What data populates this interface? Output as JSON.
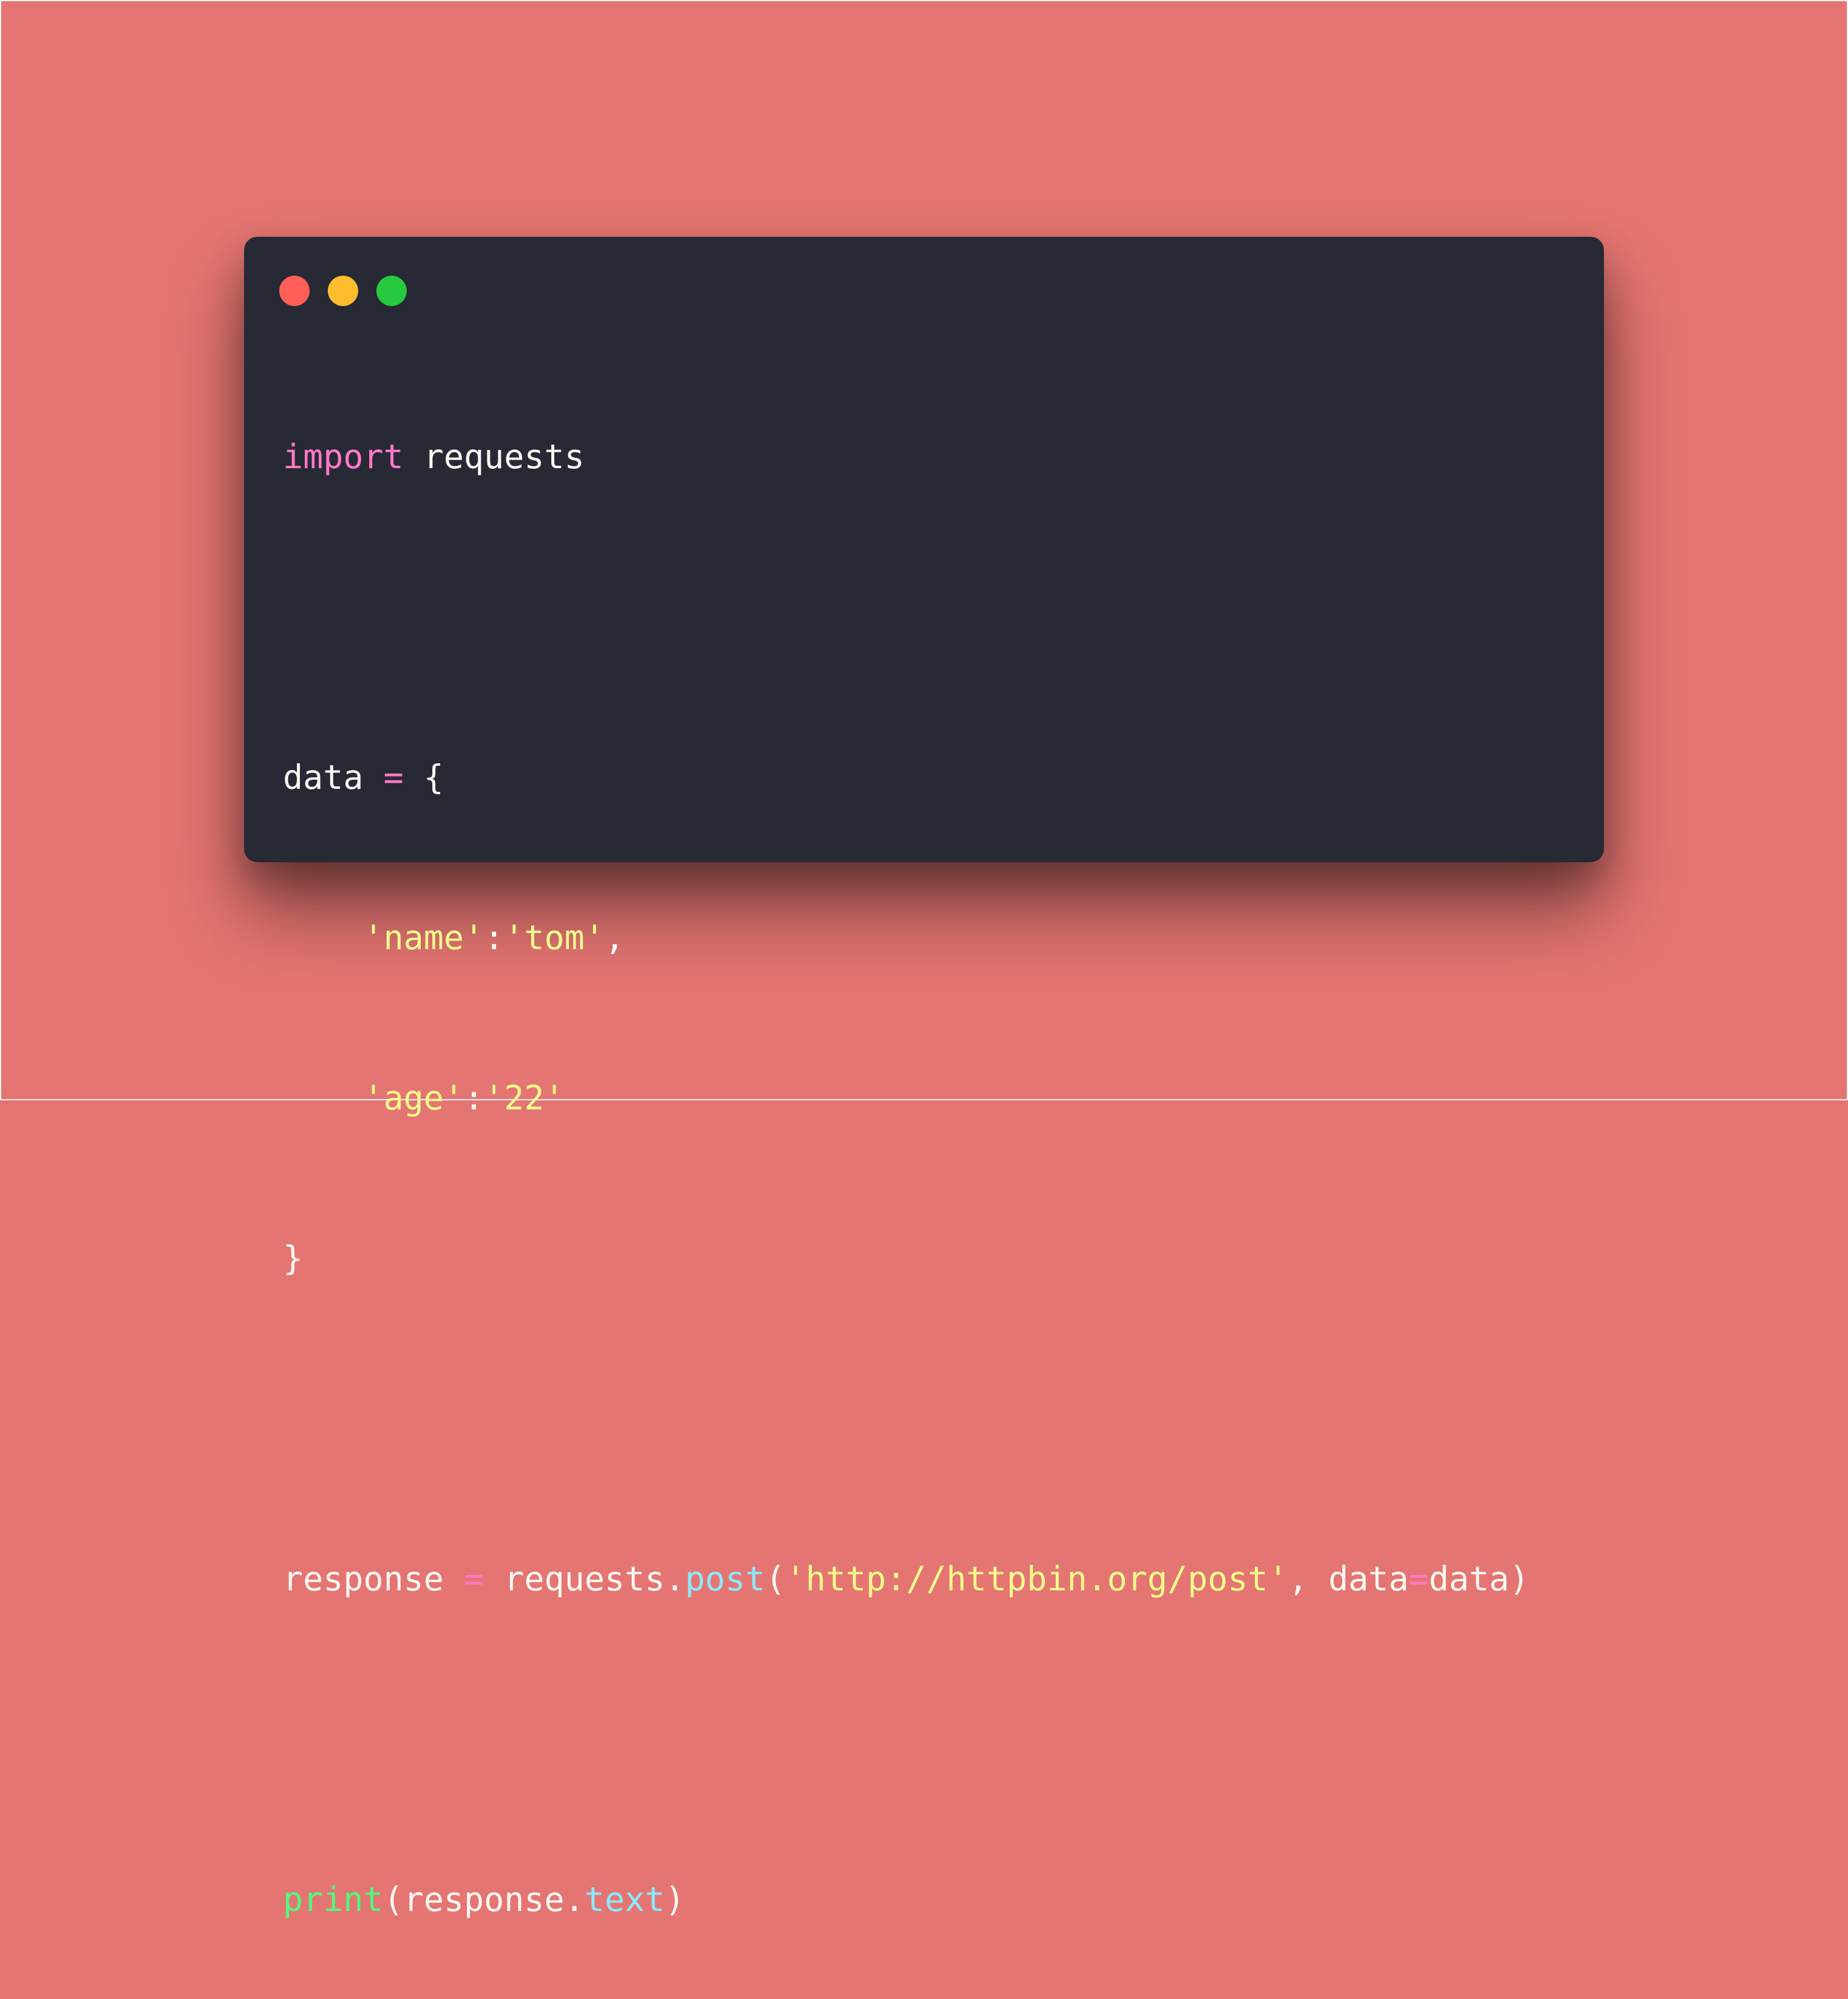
{
  "colors": {
    "background": "#e57572",
    "window": "#272935",
    "dot_close": "#ff5f56",
    "dot_minimize": "#ffbd2e",
    "dot_zoom": "#27c93f",
    "keyword": "#ff79c6",
    "string": "#f1fa8c",
    "function": "#8be9fd",
    "builtin": "#50fa7b",
    "text": "#f8f8f2"
  },
  "window_controls": {
    "close_icon": "close-dot-icon",
    "minimize_icon": "minimize-dot-icon",
    "zoom_icon": "zoom-dot-icon"
  },
  "code": {
    "language": "python",
    "line1": {
      "kw": "import",
      "rest": " requests"
    },
    "line2": {
      "name": "data",
      "sp1": " ",
      "op": "=",
      "rest": " {"
    },
    "line3": {
      "indent": "    ",
      "key": "'name'",
      "colon": ":",
      "val": "'tom'",
      "comma": ","
    },
    "line4": {
      "indent": "    ",
      "key": "'age'",
      "colon": ":",
      "val": "'22'"
    },
    "line5": {
      "brace": "}"
    },
    "line6": {
      "name": "response",
      "sp1": " ",
      "op": "=",
      "sp2": " ",
      "obj": "requests.",
      "fn": "post",
      "open": "(",
      "url": "'http://httpbin.org/post'",
      "sep": ", ",
      "kwarg": "data",
      "kwop": "=",
      "kwval": "data",
      "close": ")"
    },
    "line7": {
      "fn": "print",
      "open": "(",
      "obj": "response.",
      "attr": "text",
      "close": ")"
    }
  }
}
